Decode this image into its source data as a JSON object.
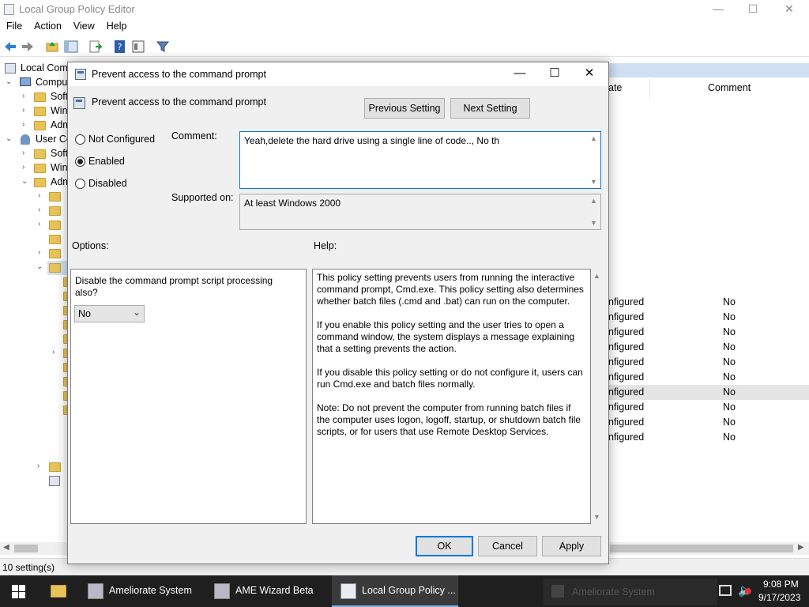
{
  "main_window": {
    "title": "Local Group Policy Editor",
    "controls": {
      "minimize": "—",
      "maximize": "☐",
      "close": "✕"
    },
    "menu": [
      "File",
      "Action",
      "View",
      "Help"
    ],
    "tree": {
      "root": "Local Comp",
      "items": [
        "Compu",
        "Soft",
        "Win",
        "Adm",
        "User Co",
        "Soft",
        "Win",
        "Adm"
      ]
    },
    "list": {
      "columns": {
        "state": "ate",
        "comment": "Comment"
      },
      "rows": [
        {
          "state": "nfigured",
          "comment": "No"
        },
        {
          "state": "nfigured",
          "comment": "No"
        },
        {
          "state": "nfigured",
          "comment": "No"
        },
        {
          "state": "nfigured",
          "comment": "No"
        },
        {
          "state": "nfigured",
          "comment": "No"
        },
        {
          "state": "nfigured",
          "comment": "No"
        },
        {
          "state": "nfigured",
          "comment": "No"
        },
        {
          "state": "nfigured",
          "comment": "No"
        },
        {
          "state": "nfigured",
          "comment": "No"
        },
        {
          "state": "nfigured",
          "comment": "No"
        }
      ]
    },
    "status": "10 setting(s)"
  },
  "dialog": {
    "title": "Prevent access to the command prompt",
    "controls": {
      "minimize": "—",
      "maximize": "☐",
      "close": "✕"
    },
    "setting_name": "Prevent access to the command prompt",
    "previous_button": "Previous Setting",
    "next_button": "Next Setting",
    "radios": {
      "not_configured": "Not Configured",
      "enabled": "Enabled",
      "disabled": "Disabled",
      "selected": "Enabled"
    },
    "comment_label": "Comment:",
    "comment_value": "Yeah,delete the hard drive using a single line of code.., No th",
    "supported_label": "Supported on:",
    "supported_value": "At least Windows 2000",
    "options_label": "Options:",
    "help_label": "Help:",
    "option_question": "Disable the command prompt script processing also?",
    "option_value": "No",
    "help_text": [
      "This policy setting prevents users from running the interactive command prompt, Cmd.exe.  This policy setting also determines whether batch files (.cmd and .bat) can run on the computer.",
      "If you enable this policy setting and the user tries to open a command window, the system displays a message explaining that a setting prevents the action.",
      "If you disable this policy setting or do not configure it, users can run Cmd.exe and batch files normally.",
      "Note: Do not prevent the computer from running batch files if the computer uses logon, logoff, startup, or shutdown batch file scripts, or for users that use Remote Desktop Services."
    ],
    "ok_button": "OK",
    "cancel_button": "Cancel",
    "apply_button": "Apply"
  },
  "taskbar": {
    "items": [
      {
        "label": "Ameliorate System"
      },
      {
        "label": "AME Wizard Beta"
      },
      {
        "label": "Local Group Policy ..."
      }
    ],
    "ghost_label": "Ameliorate System",
    "time": "9:08 PM",
    "date": "9/17/2023"
  },
  "colors": {
    "accent": "#0078d7",
    "taskbar": "#1f1f1f",
    "dialog_bg": "#f0f0f0",
    "list_header": "#cfe0f3"
  }
}
